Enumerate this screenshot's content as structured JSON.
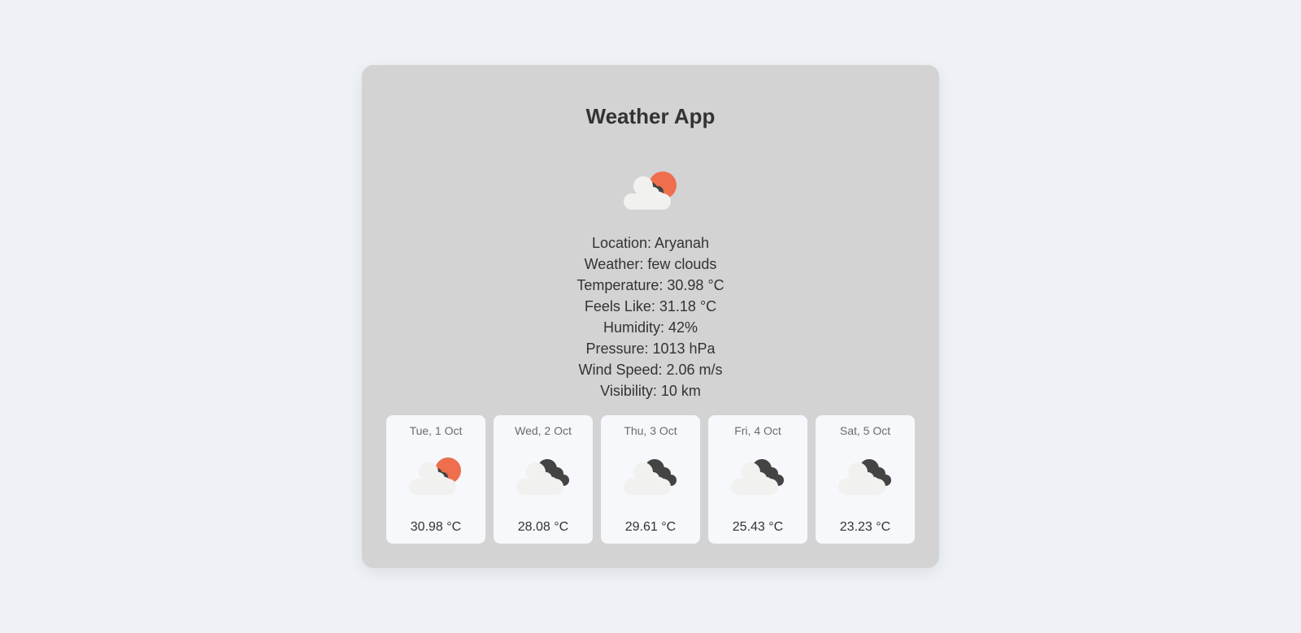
{
  "app": {
    "title": "Weather App"
  },
  "current": {
    "icon": "few-clouds-day-icon",
    "location": "Location: Aryanah",
    "weather": "Weather: few clouds",
    "temperature": "Temperature: 30.98 °C",
    "feels_like": "Feels Like: 31.18 °C",
    "humidity": "Humidity: 42%",
    "pressure": "Pressure: 1013 hPa",
    "wind_speed": "Wind Speed: 2.06 m/s",
    "visibility": "Visibility: 10 km"
  },
  "forecast": [
    {
      "date": "Tue, 1 Oct",
      "temp": "30.98 °C",
      "icon": "few-clouds-day-icon"
    },
    {
      "date": "Wed, 2 Oct",
      "temp": "28.08 °C",
      "icon": "broken-clouds-icon"
    },
    {
      "date": "Thu, 3 Oct",
      "temp": "29.61 °C",
      "icon": "broken-clouds-icon"
    },
    {
      "date": "Fri, 4 Oct",
      "temp": "25.43 °C",
      "icon": "broken-clouds-icon"
    },
    {
      "date": "Sat, 5 Oct",
      "temp": "23.23 °C",
      "icon": "broken-clouds-icon"
    }
  ],
  "colors": {
    "page_background": "#eef2f7",
    "card_background": "#d3d3d3",
    "forecast_card_background": "#f6f8fb",
    "sun": "#ee6e4d",
    "cloud_light": "#f1f1ef",
    "cloud_dark": "#444444",
    "text": "#333333"
  }
}
